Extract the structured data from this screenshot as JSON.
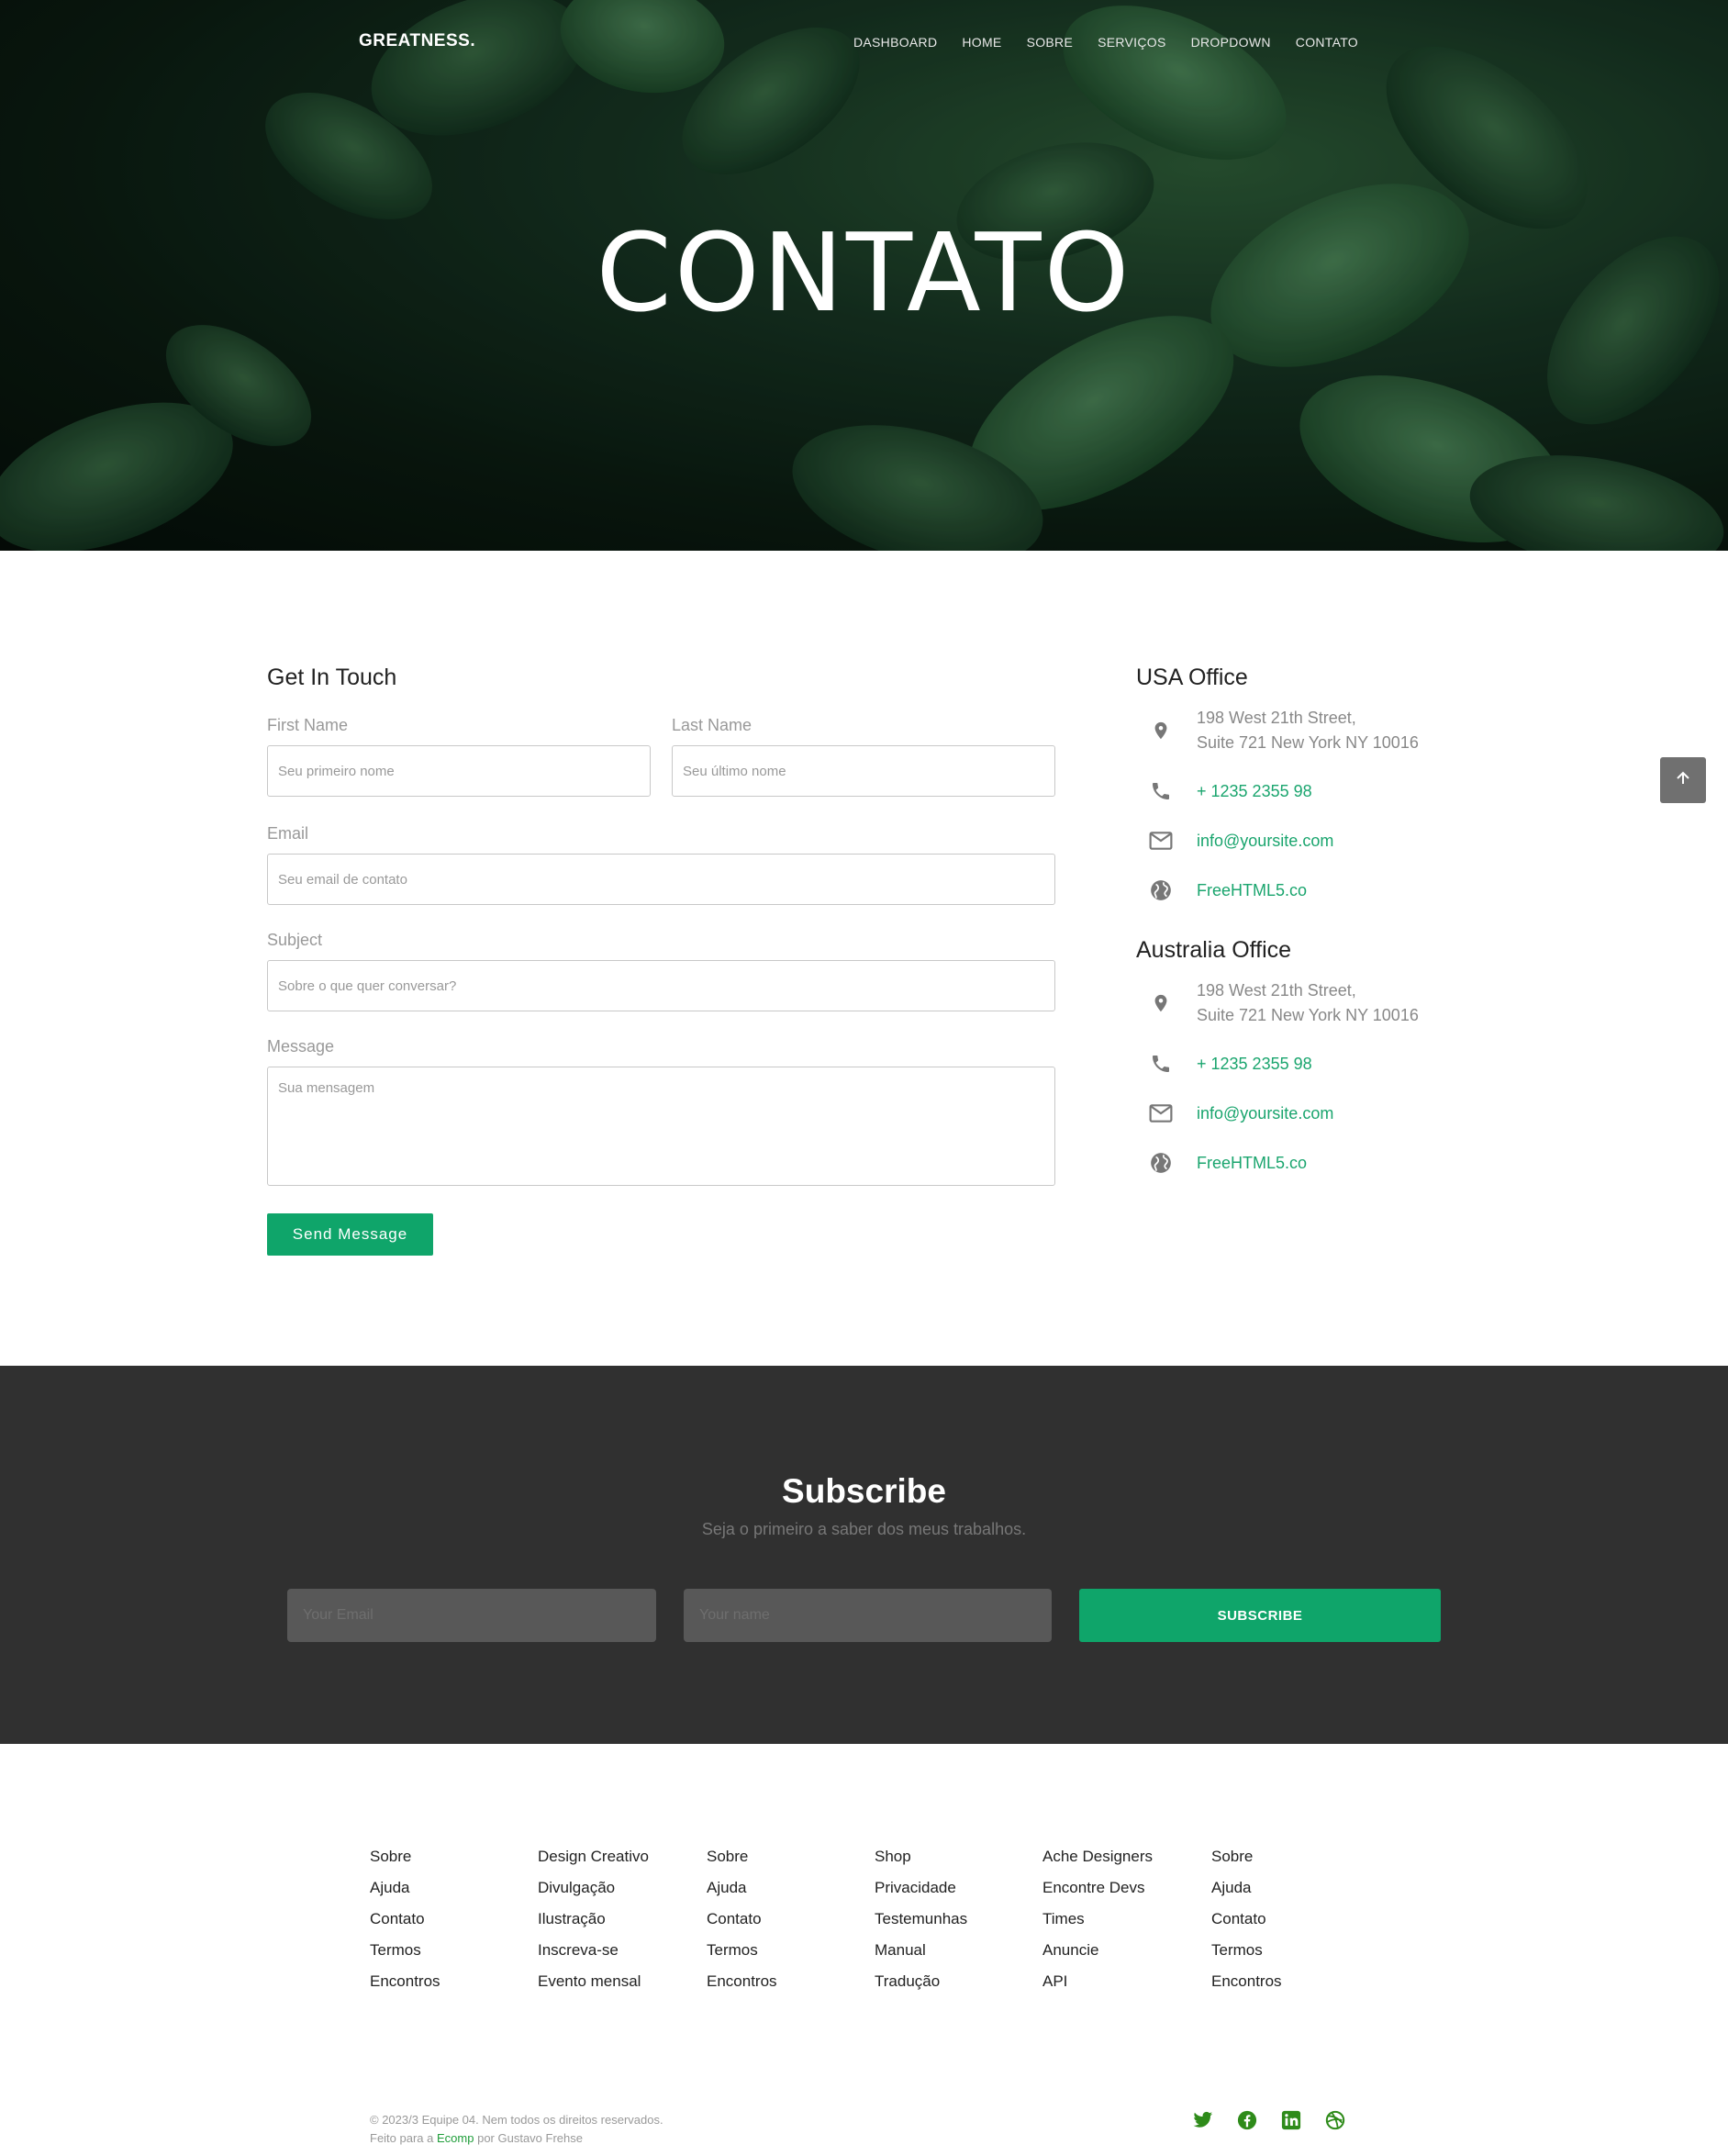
{
  "header": {
    "brand": "GREATNESS.",
    "nav": [
      "DASHBOARD",
      "HOME",
      "SOBRE",
      "SERVIÇOS",
      "DROPDOWN",
      "CONTATO"
    ],
    "hero_title": "CONTATO"
  },
  "form": {
    "title": "Get In Touch",
    "first_name_label": "First Name",
    "first_name_placeholder": "Seu primeiro nome",
    "last_name_label": "Last Name",
    "last_name_placeholder": "Seu último nome",
    "email_label": "Email",
    "email_placeholder": "Seu email de contato",
    "subject_label": "Subject",
    "subject_placeholder": "Sobre o que quer conversar?",
    "message_label": "Message",
    "message_placeholder": "Sua mensagem",
    "send_label": "Send Message"
  },
  "offices": [
    {
      "title": "USA Office",
      "address_line1": "198 West 21th Street,",
      "address_line2": "Suite 721 New York NY 10016",
      "phone": "+ 1235 2355 98",
      "email": "info@yoursite.com",
      "website": "FreeHTML5.co"
    },
    {
      "title": "Australia Office",
      "address_line1": "198 West 21th Street,",
      "address_line2": "Suite 721 New York NY 10016",
      "phone": "+ 1235 2355 98",
      "email": "info@yoursite.com",
      "website": "FreeHTML5.co"
    }
  ],
  "subscribe": {
    "title": "Subscribe",
    "description": "Seja o primeiro a saber dos meus trabalhos.",
    "email_placeholder": "Your Email",
    "name_placeholder": "Your name",
    "button_label": "SUBSCRIBE"
  },
  "footer": {
    "columns": [
      [
        "Sobre",
        "Ajuda",
        "Contato",
        "Termos",
        "Encontros"
      ],
      [
        "Design Creativo",
        "Divulgação",
        "Ilustração",
        "Inscreva-se",
        "Evento mensal"
      ],
      [
        "Sobre",
        "Ajuda",
        "Contato",
        "Termos",
        "Encontros"
      ],
      [
        "Shop",
        "Privacidade",
        "Testemunhas",
        "Manual",
        "Tradução"
      ],
      [
        "Ache Designers",
        "Encontre Devs",
        "Times",
        "Anuncie",
        "API"
      ],
      [
        "Sobre",
        "Ajuda",
        "Contato",
        "Termos",
        "Encontros"
      ]
    ],
    "copyright": "© 2023/3 Equipe 04. Nem todos os direitos reservados.",
    "made_prefix": "Feito para a",
    "made_link": "Ecomp",
    "made_suffix": "por Gustavo Frehse",
    "social": [
      "twitter-icon",
      "facebook-icon",
      "linkedin-icon",
      "dribbble-icon"
    ]
  },
  "colors": {
    "accent": "#0fa56a",
    "dark_section": "#303030",
    "social_icon": "#2e8b1a"
  }
}
